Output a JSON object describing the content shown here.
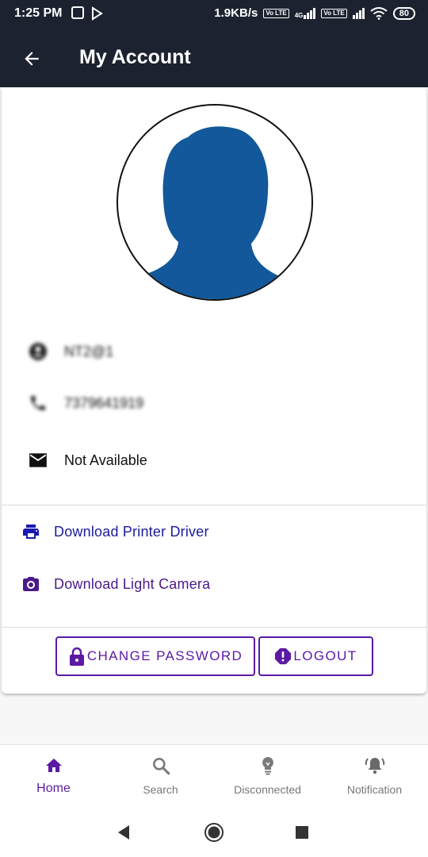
{
  "status_bar": {
    "time": "1:25 PM",
    "speed": "1.9KB/s",
    "volte1": "Vo LTE",
    "network_type": "4G",
    "volte2": "Vo LTE",
    "battery": "80"
  },
  "app_bar": {
    "title": "My Account",
    "back_icon": "arrow-back-icon"
  },
  "profile": {
    "avatar_icon": "user-silhouette-icon",
    "username": "NT2@1",
    "phone": "7379641919",
    "email": "Not Available"
  },
  "links": {
    "printer_driver": "Download Printer Driver",
    "light_camera": "Download Light Camera"
  },
  "actions": {
    "change_password": "CHANGE PASSWORD",
    "logout": "LOGOUT"
  },
  "bottom_nav": {
    "items": [
      {
        "label": "Home",
        "icon": "home-icon"
      },
      {
        "label": "Search",
        "icon": "search-icon"
      },
      {
        "label": "Disconnected",
        "icon": "bulb-icon"
      },
      {
        "label": "Notification",
        "icon": "bell-icon"
      }
    ]
  },
  "colors": {
    "appbar": "#1c2230",
    "accent": "#5b1aa3",
    "link_blue": "#1a1aa0",
    "avatar_blue": "#12589a"
  }
}
